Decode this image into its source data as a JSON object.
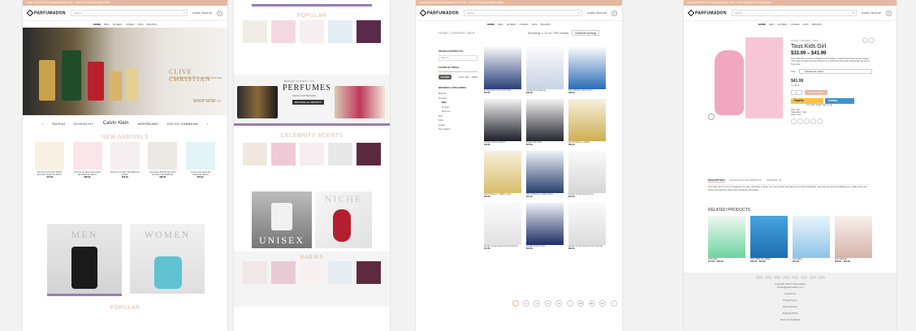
{
  "colors": {
    "accent": "#e5b9a1",
    "purple": "#9b7ab8",
    "gold": "#c49a5a"
  },
  "site": {
    "logo": "PARFUMADON",
    "topbar_text": "FREE SHIPPING ON ORDERS OVER $ 50 · 100% AUTHENTIC PERFUMES",
    "search_placeholder": "Search",
    "account": "LOGIN / SIGN UP",
    "cart_count": "0",
    "nav": [
      "HOME",
      "MEN",
      "WOMEN",
      "UNISEX",
      "KIDS",
      "BRANDS"
    ]
  },
  "home": {
    "hero_brand": "CLIVE CHRISTIAN",
    "hero_sub": "THE WORLD'S MOST EXPENSIVE PERFUME",
    "hero_shop": "SHOP NOW ›››",
    "brands": [
      "Tom Ford",
      "GIVENCHY",
      "Calvin Klein",
      "MONTBLANC",
      "DOLCE GABBANA"
    ],
    "new_arrivals_title": "NEW ARRIVALS",
    "new_arrivals": [
      {
        "name": "NAUTICA VOYAGE SPORT EAU DE TOILETTE SPRAY",
        "price": "$17.99"
      },
      {
        "name": "Parfums de Marly Delina EAU DE PARFUM SPRAY",
        "price": "$89.99"
      },
      {
        "name": "Burberry Her EAU DE PARFUM SPRAY",
        "price": "$63.99"
      },
      {
        "name": "Nasomatto BLACK AFGANO EXTRAIT DE PARFUM",
        "price": "$98.99"
      },
      {
        "name": "Armani Code EAU DE TOILETTE SPRAY",
        "price": "$55.99"
      }
    ],
    "tile_men": "MEN",
    "tile_women": "WOMEN",
    "popular_title": "POPULAR"
  },
  "home2": {
    "popular_title": "POPULAR",
    "banner_kicker": "BROAD VARIETY OF",
    "banner_title": "PERFUMES",
    "banner_sub": "FROM TOP BRANDS",
    "banner_btn": "BROWSE ALL BRANDS",
    "celebrity_title": "CELEBRITY SCENTS",
    "tile_unisex": "UNISEX",
    "tile_niche": "NICHE",
    "babies_title": "BABIES"
  },
  "shop": {
    "breadcrumb": "HOME / GENDER / MEN",
    "result_count": "Showing 1–12 of 796 results",
    "sort": "Default sorting",
    "search_products": "SEARCH PRODUCTS",
    "search_ph": "Search...",
    "price_filter": "FILTER BY PRICE",
    "filter_btn": "FILTER",
    "price_range": "Price: $0 — $400",
    "categories_title": "BROWSE CATEGORIES",
    "categories": [
      "Brands",
      "Gender",
      "Men",
      "Unisex",
      "Women",
      "Gift",
      "Kids",
      "Outlet",
      "Top Sellers"
    ],
    "products": [
      {
        "name": "Al Haramain Amber Oud Gold",
        "price": "$52.99"
      },
      {
        "name": "Arabian Oud Kalemat",
        "price": "$39.99"
      },
      {
        "name": "Issey Miyake L'Eau d'Issey",
        "price": "$38.99"
      },
      {
        "name": "Azzaro Chrome Parfum",
        "price": "$49.99"
      },
      {
        "name": "Mugler Alien Man",
        "price": "$64.99"
      },
      {
        "name": "Paco Rabanne 1 Million",
        "price": "$69.99"
      },
      {
        "name": "Paco Rabanne 1 Million Lucky",
        "price": "$58.99"
      },
      {
        "name": "Paco Rabanne 1 Million Privé",
        "price": "$61.99"
      },
      {
        "name": "Giorgio Armani Acqua di Gio",
        "price": "$54.99"
      },
      {
        "name": "Giorgio Armani Acqua di Gio Profumo",
        "price": "$72.99"
      },
      {
        "name": "Giorgio Armani Code",
        "price": "$56.99"
      },
      {
        "name": "Giorgio Armani Acqua di Gio Profondo",
        "price": "$69.99"
      }
    ],
    "pages": [
      "1",
      "2",
      "3",
      "4",
      "5",
      "…",
      "65",
      "66",
      "67",
      "›"
    ]
  },
  "product": {
    "breadcrumb": "HOME / GENDER / KIDS",
    "title": "Tous Kids Girl",
    "price": "$33.99 – $41.99",
    "description": "Tous Kids Girl by Tous is a fragrance for children. A playful floral fruity scent created with notes of sweet fruits and flowers in a charming pink bottle shaped like the iconic Tous bear.",
    "size_label": "Size",
    "size_value": "Choose an option",
    "variant_price": "$41.99",
    "stock": "In stock",
    "qty": "1",
    "add_to_cart": "ADD TO CART",
    "paypal": "PayPal",
    "venmo": "venmo",
    "paypal_note": "The safer, easier way to pay",
    "sku": "SKU: N/A",
    "cats": "Categories: Kids",
    "tags": "Tags: Tous",
    "tabs": [
      "DESCRIPTION",
      "ADDITIONAL INFORMATION",
      "REVIEWS (0)"
    ],
    "long_desc": "Tous Kids Girl by Tous is a fragrance for girls. Launched in 2012. The nose behind this fragrance is Pedro Rodriguez. Top notes are Fruits and Bergamot; middle notes are Peony and Jasmine; base notes are Musk and Vanilla.",
    "related_title": "RELATED PRODUCTS",
    "related": [
      {
        "name": "Tous Man",
        "price": "$41.99 – $52.99"
      },
      {
        "name": "Tous 1920 The Origin",
        "price": "$49.99 – $62.99"
      },
      {
        "name": "Tous Baby",
        "price": "$24.99"
      },
      {
        "name": "Tous Woman",
        "price": "$38.99 – $55.99"
      }
    ],
    "footer_copyright": "Copyright 2023 © Parfumadon",
    "footer_email": "contact@parfumadon.com",
    "footer_links": [
      "Contact Us",
      "Privacy Policy",
      "Refund Policy",
      "Shipping Policy",
      "Terms & Conditions"
    ]
  }
}
